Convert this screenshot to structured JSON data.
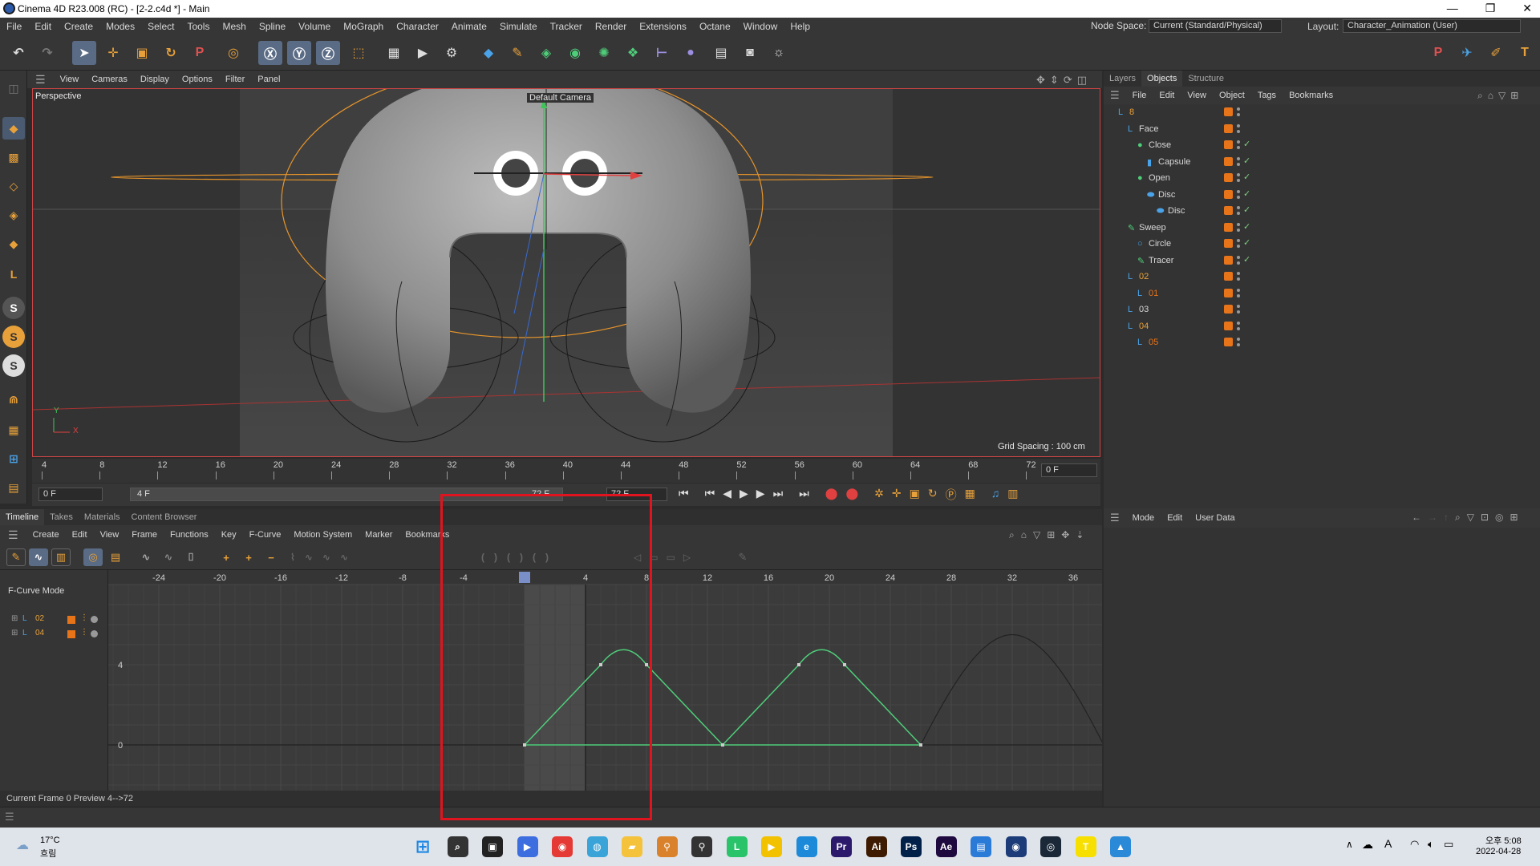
{
  "window": {
    "title": "Cinema 4D R23.008 (RC) - [2-2.c4d *] - Main",
    "controls": [
      "—",
      "❐",
      "✕"
    ]
  },
  "menubar": {
    "items": [
      "File",
      "Edit",
      "Create",
      "Modes",
      "Select",
      "Tools",
      "Mesh",
      "Spline",
      "Volume",
      "MoGraph",
      "Character",
      "Animate",
      "Simulate",
      "Tracker",
      "Render",
      "Extensions",
      "Octane",
      "Window",
      "Help"
    ],
    "node_space_label": "Node Space:",
    "node_space_value": "Current (Standard/Physical)",
    "layout_label": "Layout:",
    "layout_value": "Character_Animation (User)"
  },
  "viewport": {
    "menu": [
      "View",
      "Cameras",
      "Display",
      "Options",
      "Filter",
      "Panel"
    ],
    "label": "Perspective",
    "camera": "Default Camera",
    "grid_spacing": "Grid Spacing : 100 cm",
    "axis_y": "Y",
    "axis_x": "X"
  },
  "timeline_ruler": {
    "ticks": [
      "4",
      "8",
      "12",
      "16",
      "20",
      "24",
      "28",
      "32",
      "36",
      "40",
      "44",
      "48",
      "52",
      "56",
      "60",
      "64",
      "68",
      "72"
    ],
    "current_field": "0 F"
  },
  "playbar": {
    "start": "0 F",
    "range": "4 F",
    "end1": "72 F",
    "end2": "72 F"
  },
  "timeline_tabs": [
    "Timeline",
    "Takes",
    "Materials",
    "Content Browser"
  ],
  "timeline_menu": [
    "Create",
    "Edit",
    "View",
    "Frame",
    "Functions",
    "Key",
    "F-Curve",
    "Motion System",
    "Marker",
    "Bookmarks"
  ],
  "fcurve": {
    "mode_label": "F-Curve Mode",
    "tracks": [
      "02",
      "04"
    ],
    "x_ticks": [
      -24,
      -20,
      -16,
      -12,
      -8,
      -4,
      0,
      4,
      8,
      12,
      16,
      20,
      24,
      28,
      32,
      36
    ],
    "y_ticks": [
      4,
      0
    ]
  },
  "status": {
    "text": "Current Frame  0  Preview  4-->72"
  },
  "objects": {
    "tabs": [
      "Layers",
      "Objects",
      "Structure"
    ],
    "menu": [
      "File",
      "Edit",
      "View",
      "Object",
      "Tags",
      "Bookmarks"
    ],
    "rows": [
      {
        "name": "8",
        "depth": 0,
        "icon": "null",
        "color": "#e8a13a"
      },
      {
        "name": "Face",
        "depth": 1,
        "icon": "null",
        "color": "#d8d8d8"
      },
      {
        "name": "Close",
        "depth": 2,
        "icon": "sphere",
        "color": "#d8d8d8"
      },
      {
        "name": "Capsule",
        "depth": 3,
        "icon": "capsule",
        "color": "#d8d8d8"
      },
      {
        "name": "Open",
        "depth": 2,
        "icon": "sphere",
        "color": "#d8d8d8"
      },
      {
        "name": "Disc",
        "depth": 3,
        "icon": "disc",
        "color": "#d8d8d8"
      },
      {
        "name": "Disc",
        "depth": 4,
        "icon": "disc",
        "color": "#d8d8d8"
      },
      {
        "name": "Sweep",
        "depth": 1,
        "icon": "sweep",
        "color": "#d8d8d8"
      },
      {
        "name": "Circle",
        "depth": 2,
        "icon": "circle",
        "color": "#d8d8d8"
      },
      {
        "name": "Tracer",
        "depth": 2,
        "icon": "tracer",
        "color": "#d8d8d8"
      },
      {
        "name": "02",
        "depth": 1,
        "icon": "null",
        "color": "#e8a13a"
      },
      {
        "name": "01",
        "depth": 2,
        "icon": "null",
        "color": "#e8741a"
      },
      {
        "name": "03",
        "depth": 1,
        "icon": "null",
        "color": "#d8d8d8"
      },
      {
        "name": "04",
        "depth": 1,
        "icon": "null",
        "color": "#e8a13a"
      },
      {
        "name": "05",
        "depth": 2,
        "icon": "null",
        "color": "#e8741a"
      }
    ]
  },
  "attributes": {
    "menu": [
      "Mode",
      "Edit",
      "User Data"
    ]
  },
  "taskbar": {
    "weather_temp": "17°C",
    "weather_desc": "흐림",
    "ime": "A",
    "time": "오후 5:08",
    "date": "2022-04-28",
    "apps": [
      "windows-start",
      "search",
      "task-view",
      "zoom-meet",
      "chrome",
      "app-a",
      "explorer",
      "app-b",
      "app-c",
      "line",
      "kakao-player",
      "edge",
      "premiere",
      "illustrator",
      "photoshop",
      "after-effects",
      "notes",
      "cinema4d",
      "steam",
      "kakaotalk",
      "photos"
    ]
  },
  "colors": {
    "accent_orange": "#e8741a",
    "curve_green": "#4fce7a",
    "highlight_red": "#e0141e",
    "selection_blue": "#5a6b85"
  }
}
